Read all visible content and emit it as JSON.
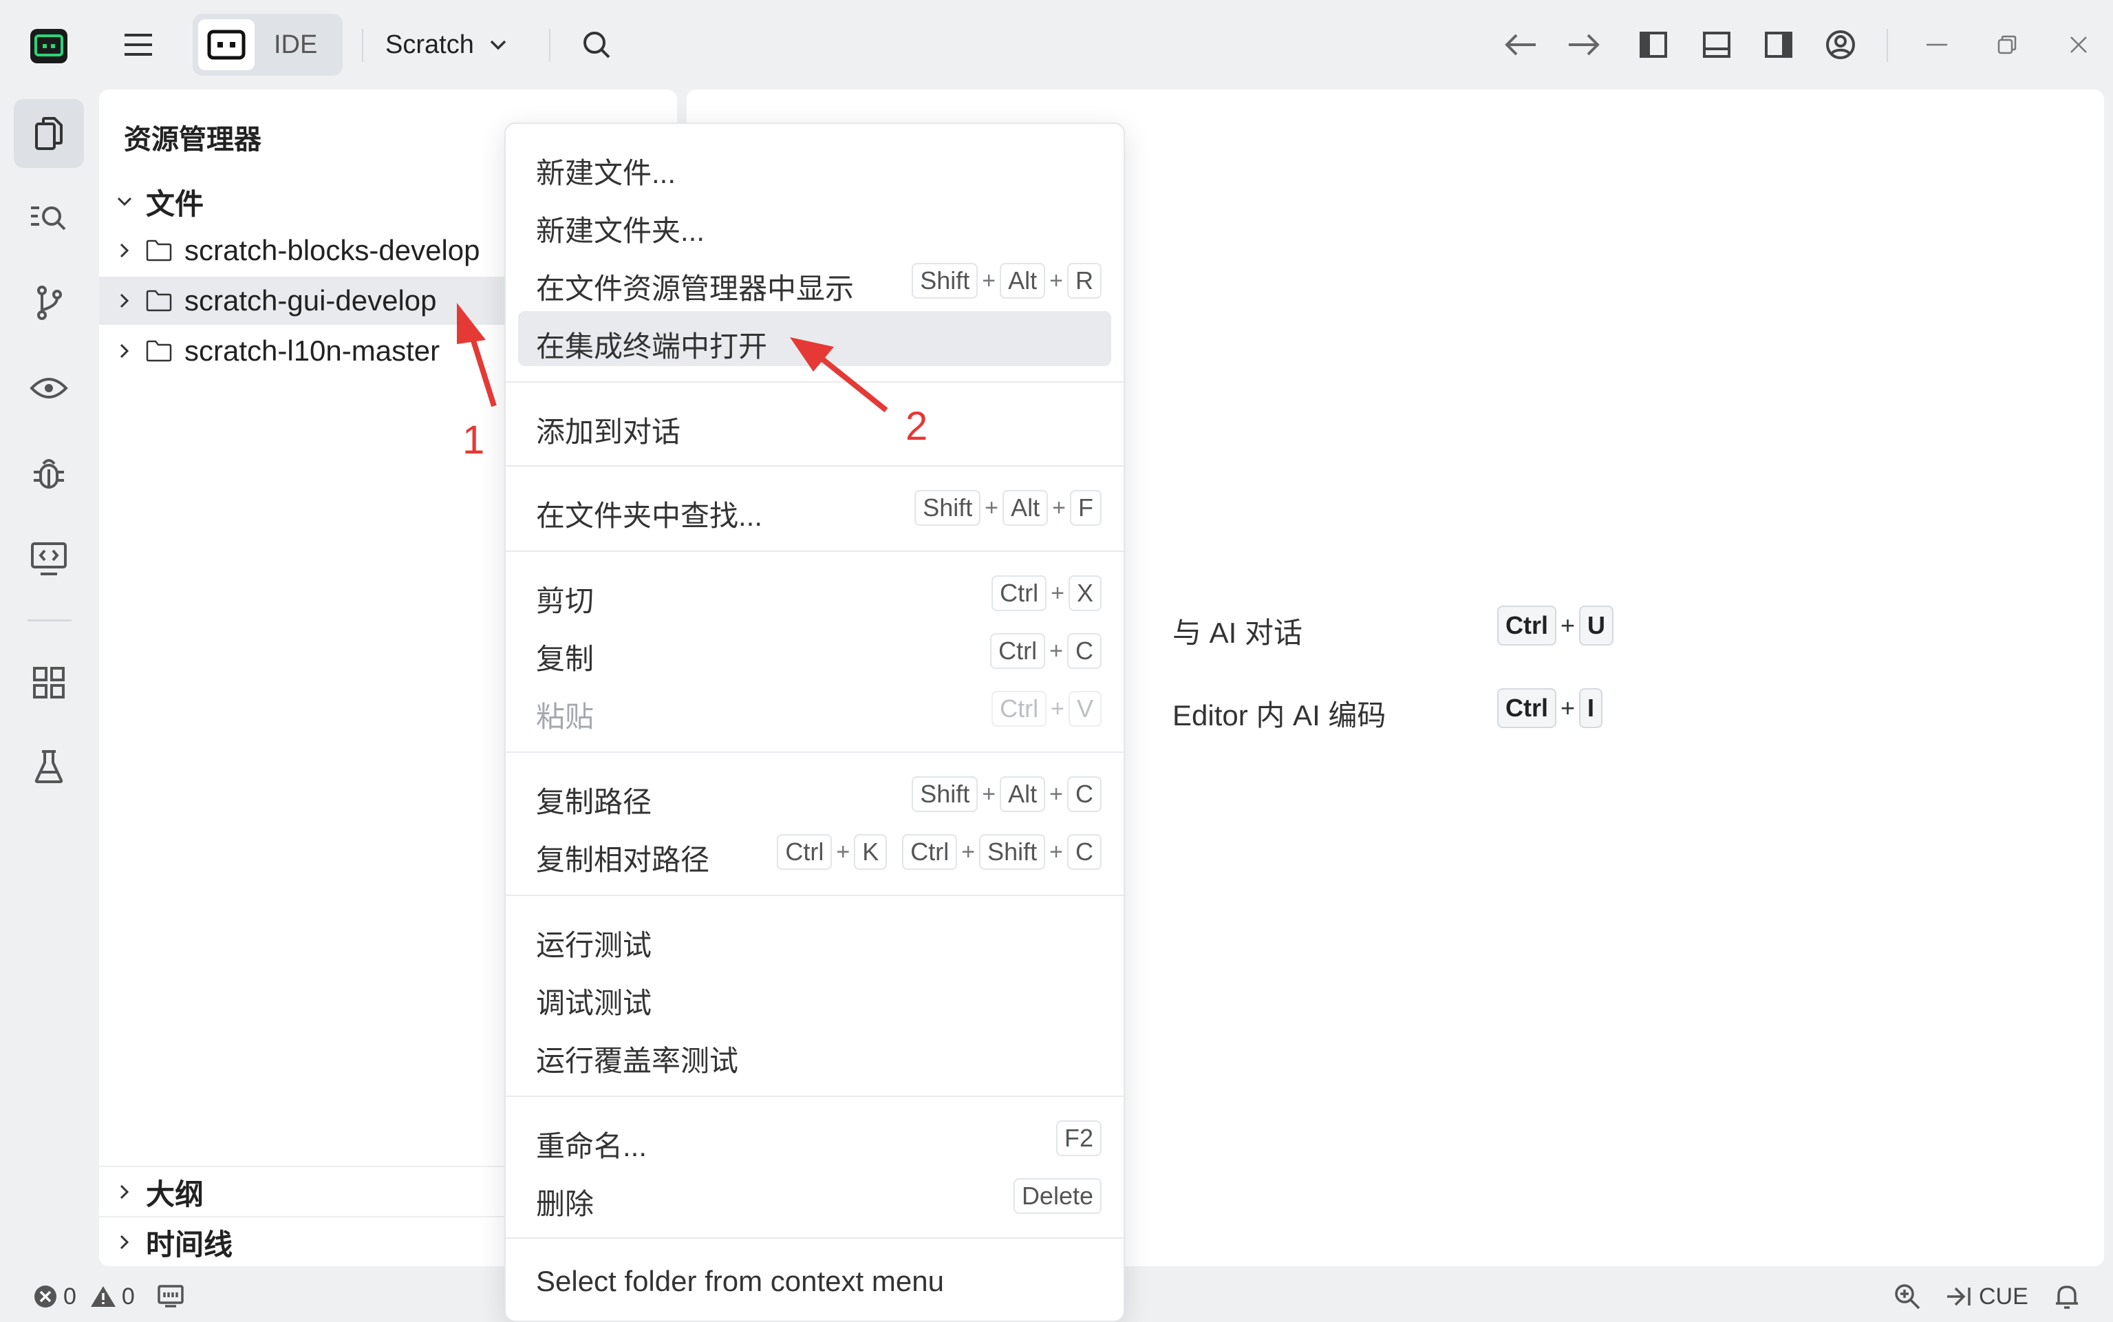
{
  "titlebar": {
    "mode_label": "IDE",
    "project_label": "Scratch"
  },
  "explorer": {
    "title": "资源管理器",
    "files_section": "文件",
    "folders": [
      {
        "name": "scratch-blocks-develop"
      },
      {
        "name": "scratch-gui-develop"
      },
      {
        "name": "scratch-l10n-master"
      }
    ],
    "outline_section": "大纲",
    "timeline_section": "时间线"
  },
  "editor": {
    "hints": [
      {
        "label": "与 AI 对话",
        "keys": [
          "Ctrl",
          "U"
        ]
      },
      {
        "label": "Editor 内 AI 编码",
        "keys": [
          "Ctrl",
          "I"
        ]
      }
    ]
  },
  "context_menu": {
    "items": [
      {
        "label": "新建文件..."
      },
      {
        "label": "新建文件夹..."
      },
      {
        "label": "在文件资源管理器中显示",
        "shortcut": [
          "Shift",
          "Alt",
          "R"
        ]
      },
      {
        "label": "在集成终端中打开"
      },
      {
        "label": "添加到对话"
      },
      {
        "label": "在文件夹中查找...",
        "shortcut": [
          "Shift",
          "Alt",
          "F"
        ]
      },
      {
        "label": "剪切",
        "shortcut": [
          "Ctrl",
          "X"
        ]
      },
      {
        "label": "复制",
        "shortcut": [
          "Ctrl",
          "C"
        ]
      },
      {
        "label": "粘贴",
        "shortcut": [
          "Ctrl",
          "V"
        ]
      },
      {
        "label": "复制路径",
        "shortcut": [
          "Shift",
          "Alt",
          "C"
        ]
      },
      {
        "label": "复制相对路径",
        "shortcut": [
          "Ctrl",
          "K"
        ],
        "shortcut2": [
          "Ctrl",
          "Shift",
          "C"
        ]
      },
      {
        "label": "运行测试"
      },
      {
        "label": "调试测试"
      },
      {
        "label": "运行覆盖率测试"
      },
      {
        "label": "重命名...",
        "shortcut": [
          "F2"
        ]
      },
      {
        "label": "删除",
        "shortcut": [
          "Delete"
        ]
      },
      {
        "label": "Select folder from context menu"
      }
    ]
  },
  "statusbar": {
    "errors": "0",
    "warnings": "0",
    "cue": "CUE"
  },
  "annotations": {
    "step1": "1",
    "step2": "2"
  },
  "colors": {
    "accent_logo": "#2bd47a",
    "annotation_red": "#e53935",
    "hover_bg": "#e8eaed"
  }
}
